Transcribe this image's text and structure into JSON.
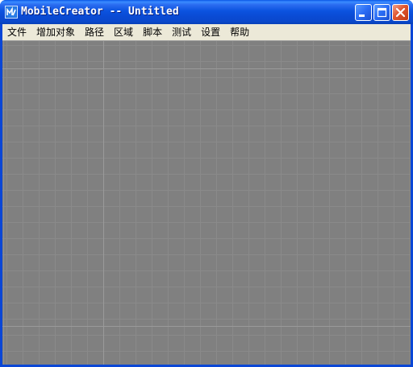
{
  "window": {
    "title": "MobileCreator -- Untitled",
    "icon": "mobilecreator-app-icon",
    "controls": {
      "minimize_icon": "minimize-icon",
      "maximize_icon": "maximize-icon",
      "close_icon": "close-icon"
    },
    "colors": {
      "titlebar": "#0a4ad3",
      "close": "#e0552e",
      "menubar": "#ece9d8",
      "canvas": "#808080",
      "grid": "#8a8a8a"
    }
  },
  "menu": {
    "items": [
      {
        "id": "file",
        "label": "文件"
      },
      {
        "id": "add-object",
        "label": "增加对象"
      },
      {
        "id": "path",
        "label": "路径"
      },
      {
        "id": "region",
        "label": "区域"
      },
      {
        "id": "script",
        "label": "脚本"
      },
      {
        "id": "test",
        "label": "测试"
      },
      {
        "id": "settings",
        "label": "设置"
      },
      {
        "id": "help",
        "label": "帮助"
      }
    ]
  }
}
